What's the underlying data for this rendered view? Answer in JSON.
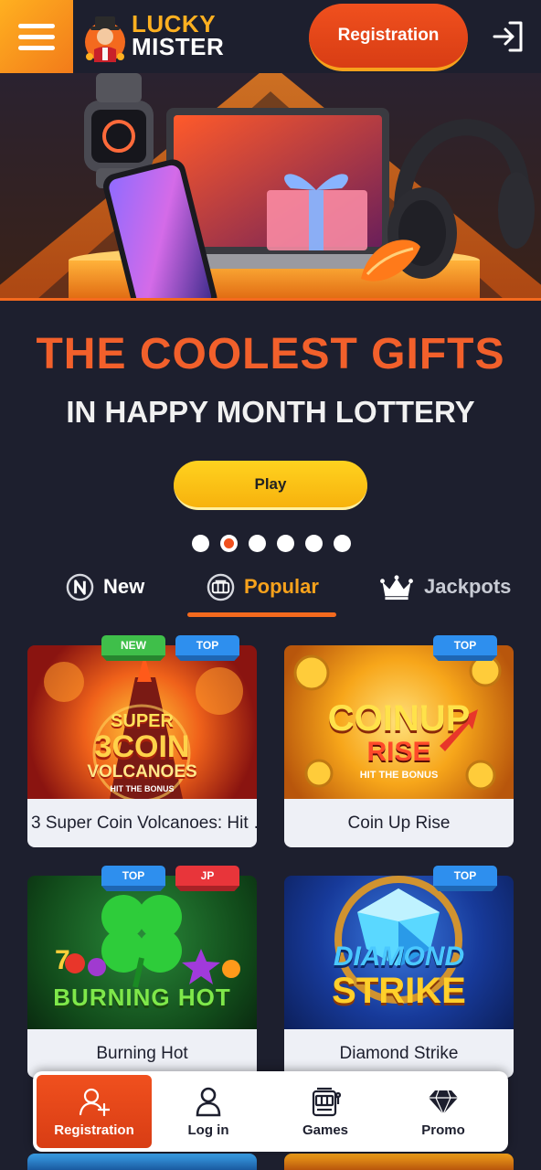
{
  "header": {
    "menu_icon": "hamburger-icon",
    "logo_line1": "LUCKY",
    "logo_line2": "MISTER",
    "register_label": "Registration",
    "login_icon": "sign-in-icon"
  },
  "promo": {
    "title": "THE COOLEST GIFTS",
    "subtitle": "IN HAPPY MONTH LOTTERY",
    "play_label": "Play",
    "slide_count": 6,
    "active_slide": 2
  },
  "tabs": [
    {
      "label": "New",
      "icon": "n-circle-icon",
      "active": false
    },
    {
      "label": "Popular",
      "icon": "slot-reels-icon",
      "active": true
    },
    {
      "label": "Jackpots",
      "icon": "crown-icon",
      "active": false
    }
  ],
  "games": [
    {
      "name": "3 Super Coin Volcanoes: Hit …",
      "badges": [
        "NEW",
        "TOP"
      ],
      "thumb_line1": "SUPER",
      "thumb_line2": "3COIN",
      "thumb_line3": "VOLCANOES",
      "thumb_line4": "HIT THE BONUS"
    },
    {
      "name": "Coin Up Rise",
      "badges": [
        "TOP"
      ],
      "thumb_line1": "COINUP",
      "thumb_line2": "RISE",
      "thumb_line3": "HIT THE BONUS"
    },
    {
      "name": "Burning Hot",
      "badges": [
        "TOP",
        "JP"
      ],
      "thumb_line1": "BURNING HOT"
    },
    {
      "name": "Diamond Strike",
      "badges": [
        "TOP"
      ],
      "thumb_line1": "DIAMOND",
      "thumb_line2": "STRIKE"
    }
  ],
  "bottom_nav": [
    {
      "label": "Registration",
      "icon": "user-plus-icon",
      "active": true
    },
    {
      "label": "Log in",
      "icon": "user-icon",
      "active": false
    },
    {
      "label": "Games",
      "icon": "slot-machine-icon",
      "active": false
    },
    {
      "label": "Promo",
      "icon": "diamond-icon",
      "active": false
    }
  ],
  "colors": {
    "background": "#1d1f2e",
    "accent_orange": "#f0501e",
    "accent_yellow": "#f7b20d",
    "tab_active": "#f7a21c"
  }
}
